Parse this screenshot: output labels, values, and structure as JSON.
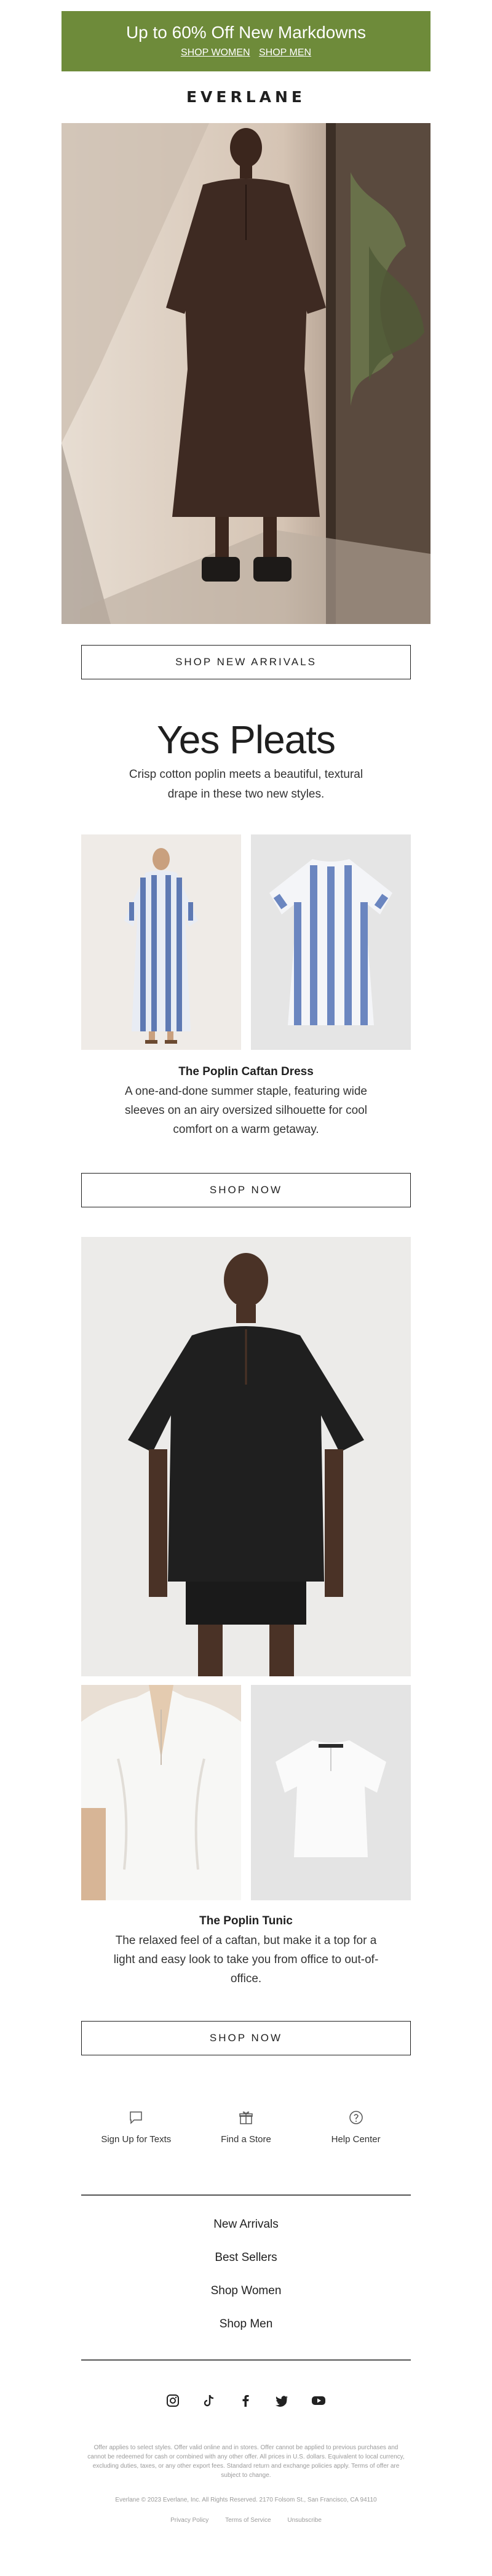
{
  "banner": {
    "title": "Up to 60% Off New Markdowns",
    "link_women": "SHOP WOMEN",
    "link_men": "SHOP MEN",
    "color": "#6e8b3a"
  },
  "brand": {
    "logo": "EVERLANE"
  },
  "hero": {
    "cta": "SHOP NEW ARRIVALS"
  },
  "section": {
    "title": "Yes Pleats",
    "subtitle": "Crisp cotton poplin meets a beautiful, textural drape in these two new styles."
  },
  "products": [
    {
      "name": "The Poplin Caftan Dress",
      "description": "A one-and-done summer staple, featuring wide sleeves on an airy oversized silhouette for cool comfort on a warm getaway.",
      "cta": "SHOP NOW"
    },
    {
      "name": "The Poplin Tunic",
      "description": "The relaxed feel of a caftan, but make it a top for a light and easy look to take you from office to out-of-office.",
      "cta": "SHOP NOW"
    }
  ],
  "footer": {
    "services": [
      {
        "label": "Sign Up for Texts",
        "icon": "chat-bubble-icon"
      },
      {
        "label": "Find a Store",
        "icon": "gift-icon"
      },
      {
        "label": "Help Center",
        "icon": "question-icon"
      }
    ],
    "nav": [
      "New Arrivals",
      "Best Sellers",
      "Shop Women",
      "Shop Men"
    ],
    "social": [
      "instagram-icon",
      "tiktok-icon",
      "facebook-icon",
      "twitter-icon",
      "youtube-icon"
    ],
    "legal": "Offer applies to select styles. Offer valid online and in stores. Offer cannot be applied to previous purchases and cannot be redeemed for cash or combined with any other offer. All prices in U.S. dollars. Equivalent to local currency, excluding duties, taxes, or any other export fees. Standard return and exchange policies apply. Terms of offer are subject to change.",
    "copyright": "Everlane © 2023 Everlane, Inc. All Rights Reserved. 2170 Folsom St., San Francisco, CA 94110",
    "links": [
      "Privacy Policy",
      "Terms of Service",
      "Unsubscribe"
    ]
  }
}
